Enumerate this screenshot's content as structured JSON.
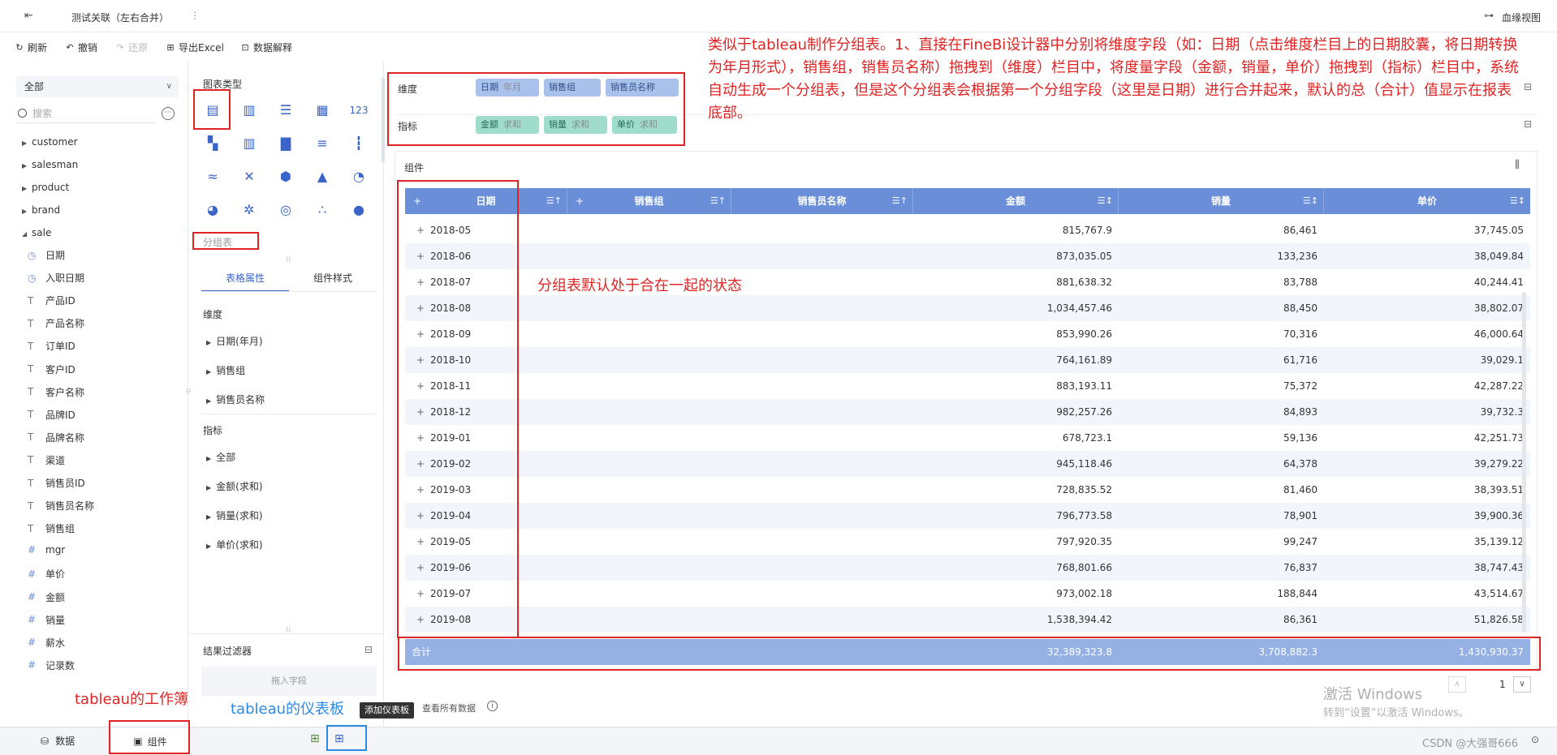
{
  "topbar": {
    "title": "测试关联（左右合并）",
    "lineage": "血缘视图"
  },
  "toolbar": {
    "refresh": "刷新",
    "undo": "撤销",
    "redo": "还原",
    "export": "导出Excel",
    "explain": "数据解释"
  },
  "left": {
    "select": "全部",
    "search_placeholder": "搜索",
    "tree": [
      "customer",
      "salesman",
      "product",
      "brand",
      "sale"
    ],
    "fields": [
      {
        "icon": "clock-icon",
        "label": "日期"
      },
      {
        "icon": "clock-icon",
        "label": "入职日期"
      },
      {
        "icon": "text-icon",
        "label": "产品ID"
      },
      {
        "icon": "text-icon",
        "label": "产品名称"
      },
      {
        "icon": "text-icon",
        "label": "订单ID"
      },
      {
        "icon": "text-icon",
        "label": "客户ID"
      },
      {
        "icon": "text-icon",
        "label": "客户名称"
      },
      {
        "icon": "text-icon",
        "label": "品牌ID"
      },
      {
        "icon": "text-icon",
        "label": "品牌名称"
      },
      {
        "icon": "text-icon",
        "label": "渠道"
      },
      {
        "icon": "text-icon",
        "label": "销售员ID"
      },
      {
        "icon": "text-icon",
        "label": "销售员名称"
      },
      {
        "icon": "text-icon",
        "label": "销售组"
      },
      {
        "icon": "hash-icon",
        "label": "mgr"
      },
      {
        "icon": "hash-icon",
        "label": "单价"
      },
      {
        "icon": "hash-icon",
        "label": "金额"
      },
      {
        "icon": "hash-icon",
        "label": "销量"
      },
      {
        "icon": "hash-icon",
        "label": "薪水"
      },
      {
        "icon": "hash-icon",
        "label": "记录数"
      }
    ]
  },
  "mid": {
    "chart_type_label": "图表类型",
    "chart_type_selected": "分组表",
    "tab_props": "表格属性",
    "tab_style": "组件样式",
    "dim_title": "维度",
    "dims": [
      "日期(年月)",
      "销售组",
      "销售员名称"
    ],
    "measure_title": "指标",
    "measures": [
      "全部",
      "金额(求和)",
      "销量(求和)",
      "单价(求和)"
    ],
    "filter_title": "结果过滤器",
    "filter_drop": "拖入字段"
  },
  "shelves": {
    "dim_label": "维度",
    "measure_label": "指标",
    "dim_pills": [
      {
        "name": "日期",
        "sub": "年月"
      },
      {
        "name": "销售组",
        "sub": ""
      },
      {
        "name": "销售员名称",
        "sub": ""
      }
    ],
    "measure_pills": [
      {
        "name": "金额",
        "sub": "求和"
      },
      {
        "name": "销量",
        "sub": "求和"
      },
      {
        "name": "单价",
        "sub": "求和"
      }
    ]
  },
  "component": {
    "title": "组件"
  },
  "table": {
    "headers": [
      "日期",
      "销售组",
      "销售员名称",
      "金额",
      "销量",
      "单价"
    ],
    "rows": [
      [
        "2018-05",
        "815,767.9",
        "86,461",
        "37,745.05"
      ],
      [
        "2018-06",
        "873,035.05",
        "133,236",
        "38,049.84"
      ],
      [
        "2018-07",
        "881,638.32",
        "83,788",
        "40,244.41"
      ],
      [
        "2018-08",
        "1,034,457.46",
        "88,450",
        "38,802.07"
      ],
      [
        "2018-09",
        "853,990.26",
        "70,316",
        "46,000.64"
      ],
      [
        "2018-10",
        "764,161.89",
        "61,716",
        "39,029.1"
      ],
      [
        "2018-11",
        "883,193.11",
        "75,372",
        "42,287.22"
      ],
      [
        "2018-12",
        "982,257.26",
        "84,893",
        "39,732.3"
      ],
      [
        "2019-01",
        "678,723.1",
        "59,136",
        "42,251.73"
      ],
      [
        "2019-02",
        "945,118.46",
        "64,378",
        "39,279.22"
      ],
      [
        "2019-03",
        "728,835.52",
        "81,460",
        "38,393.51"
      ],
      [
        "2019-04",
        "796,773.58",
        "78,901",
        "39,900.36"
      ],
      [
        "2019-05",
        "797,920.35",
        "99,247",
        "35,139.12"
      ],
      [
        "2019-06",
        "768,801.66",
        "76,837",
        "38,747.43"
      ],
      [
        "2019-07",
        "973,002.18",
        "188,844",
        "43,514.67"
      ],
      [
        "2019-08",
        "1,538,394.42",
        "86,361",
        "51,826.58"
      ]
    ],
    "total_label": "合计",
    "total": [
      "32,389,323.8",
      "3,708,882.3",
      "1,430,930.37"
    ]
  },
  "pager": {
    "page": "1"
  },
  "footer": {
    "view_all": "查看所有数据"
  },
  "bottom": {
    "tab_data": "数据",
    "tab_component": "组件",
    "tooltip": "添加仪表板"
  },
  "annotations": {
    "main": "类似于tableau制作分组表。1、直接在FineBi设计器中分别将维度字段（如：日期（点击维度栏目上的日期胶囊，将日期转换为年月形式），销售组，销售员名称）拖拽到（维度）栏目中，将度量字段（金额，销量，单价）拖拽到（指标）栏目中，系统自动生成一个分组表，但是这个分组表会根据第一个分组字段（这里是日期）进行合并起来，默认的总（合计）值显示在报表底部。",
    "merged": "分组表默认处于合在一起的状态",
    "workbook": "tableau的工作簿",
    "dashboard": "tableau的仪表板"
  },
  "watermark": {
    "line1": "激活 Windows",
    "line2": "转到“设置”以激活 Windows。",
    "csdn": "CSDN @大强哥666"
  },
  "colors": {
    "accent": "#3a64c8",
    "header": "#6a8fd8",
    "total": "#95b1e3",
    "dim_pill": "#a9c2ec",
    "measure_pill": "#9fdccb",
    "annotation": "#e02424"
  }
}
